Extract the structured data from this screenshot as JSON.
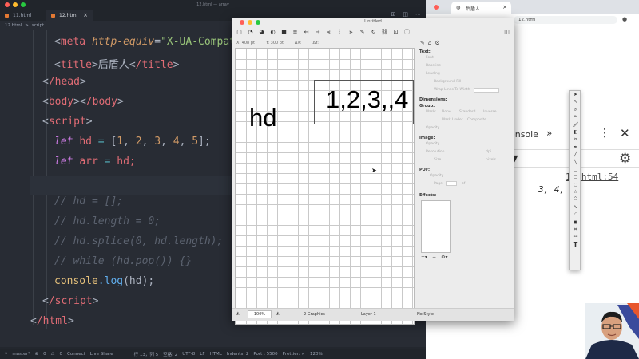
{
  "editor": {
    "window_title": "12.html — array",
    "tabs": [
      {
        "label": "11.html",
        "close": "×"
      },
      {
        "label": "12.html",
        "close": "×"
      }
    ],
    "breadcrumb": [
      "12.html",
      ">",
      "script"
    ],
    "code": {
      "meta_tag": "meta",
      "meta_attr": "http-equiv",
      "meta_eq": "=",
      "meta_val": "\"X-UA-Compat",
      "title_open": "title",
      "title_text": "后盾人",
      "title_close": "/title",
      "head_close": "/head",
      "body_open": "body",
      "body_close": "/body",
      "script_open": "script",
      "let1": "let",
      "hd": "hd",
      "assign": " = ",
      "arr_open": "[",
      "n1": "1",
      "n2": "2",
      "n3": "3",
      "n4": "4",
      "n5": "5",
      "comma": ", ",
      "arr_close": "];",
      "let2": "let",
      "arr_name": "arr",
      "hd_ref": "hd;",
      "c1": "// hd = [];",
      "c2": "// hd.length = 0;",
      "c3": "// hd.splice(0, hd.length);",
      "c4": "// while (hd.pop()) {}",
      "console": "console",
      "log": ".log",
      "log_args": "(hd);",
      "script_close": "/script",
      "html_close": "/html"
    },
    "status": {
      "branch": "master*",
      "errors": "0",
      "warnings": "0",
      "connect": "Connect",
      "live_share": "Live Share",
      "position": "行 13，列 5",
      "spaces": "空格: 2",
      "encoding": "UTF-8",
      "eol": "LF",
      "language": "HTML",
      "indents": "Indents: 2",
      "port": "Port : 5500",
      "prettier": "Prettier: ✓",
      "zoom": "120%"
    }
  },
  "browser": {
    "tab_title": "后盾人",
    "url": "12.html",
    "devtools": {
      "console_tab": "onsole",
      "more": "»",
      "source_ref": "12.html:54",
      "output": "3, 4, 5]"
    }
  },
  "graphic_app": {
    "title": "Untitled",
    "ruler": {
      "x": "X: 408 pt",
      "y": "Y: 300 pt",
      "dx": "ΔX:",
      "dy": "ΔY:"
    },
    "canvas_text": {
      "large_label": "hd",
      "box_text": "1,2,3,,4"
    },
    "inspector": {
      "text": "Text:",
      "font": "Font",
      "baseline": "Baseline",
      "leading": "Leading",
      "background_fill": "Background Fill",
      "wrap": "Wrap Lines To Width",
      "dimensions": "Dimensions:",
      "group": "Group:",
      "mask": "Mask:",
      "mask_opts": [
        "None",
        "Standard",
        "Inverse"
      ],
      "mask_under": "Mask Under",
      "composite": "Composite",
      "opacity": "Opacity",
      "image": "Image:",
      "image_opacity": "Opacity",
      "resolution": "Resolution",
      "dpi": "dpi",
      "size": "Size",
      "pixels": "pixels",
      "pdf": "PDF:",
      "pdf_opacity": "Opacity",
      "page": "Page",
      "of": "of",
      "effects": "Effects:"
    },
    "bottom": {
      "zoom": "100%",
      "graphics": "2 Graphics",
      "layer": "Layer 1",
      "style": "No Style"
    }
  },
  "colors": {
    "editor_bg": "#282c34",
    "chrome_bg": "#21252b",
    "tag": "#e06c75",
    "keyword": "#c678dd",
    "number": "#d19a66",
    "string": "#98c379",
    "comment": "#5c6370"
  }
}
